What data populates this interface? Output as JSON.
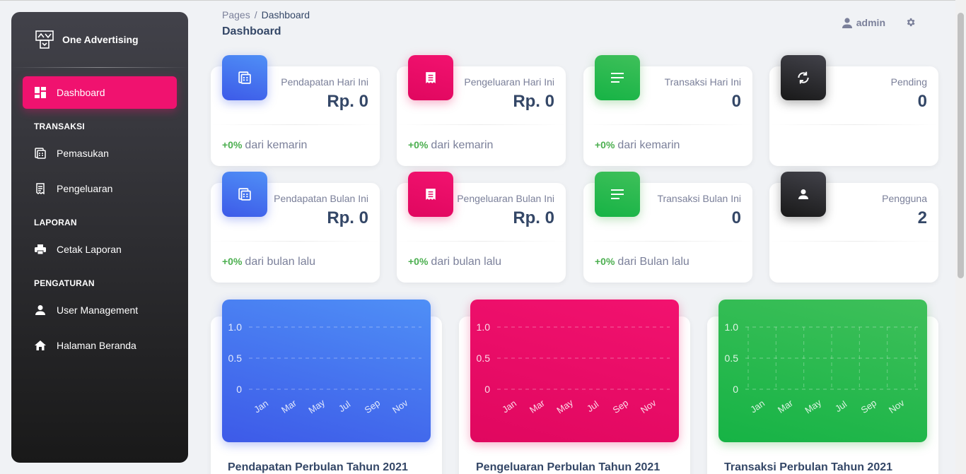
{
  "sidebar": {
    "brand": "One Advertising",
    "items": {
      "dashboard": "Dashboard",
      "section_transaksi": "TRANSAKSI",
      "pemasukan": "Pemasukan",
      "pengeluaran": "Pengeluaran",
      "section_laporan": "LAPORAN",
      "cetak_laporan": "Cetak Laporan",
      "section_pengaturan": "PENGATURAN",
      "user_management": "User Management",
      "halaman_beranda": "Halaman Beranda"
    }
  },
  "header": {
    "breadcrumb_root": "Pages",
    "breadcrumb_sep": "/",
    "breadcrumb_current": "Dashboard",
    "title": "Dashboard",
    "user": "admin"
  },
  "cards": [
    {
      "label": "Pendapatan Hari Ini",
      "value": "Rp. 0",
      "pct": "+0%",
      "foot": "dari kemarin",
      "icon": "calculator-icon"
    },
    {
      "label": "Pengeluaran Hari Ini",
      "value": "Rp. 0",
      "pct": "+0%",
      "foot": "dari kemarin",
      "icon": "receipt-icon"
    },
    {
      "label": "Transaksi Hari Ini",
      "value": "0",
      "pct": "+0%",
      "foot": "dari kemarin",
      "icon": "list-icon"
    },
    {
      "label": "Pending",
      "value": "0",
      "icon": "refresh-icon"
    },
    {
      "label": "Pendapatan Bulan Ini",
      "value": "Rp. 0",
      "pct": "+0%",
      "foot": "dari bulan lalu",
      "icon": "calculator-icon"
    },
    {
      "label": "Pengeluaran Bulan Ini",
      "value": "Rp. 0",
      "pct": "+0%",
      "foot": "dari bulan lalu",
      "icon": "receipt-icon"
    },
    {
      "label": "Transaksi Bulan Ini",
      "value": "0",
      "pct": "+0%",
      "foot": "dari Bulan lalu",
      "icon": "list-icon"
    },
    {
      "label": "Pengguna",
      "value": "2",
      "icon": "person-icon"
    }
  ],
  "colors": {
    "blue": "#3d5ae8",
    "pink": "#f0126f",
    "green": "#16b345",
    "dark": "#191919",
    "positive": "#4caf50"
  },
  "chart_data": [
    {
      "type": "line",
      "title": "Pendapatan Perbulan Tahun 2021",
      "x_tick_labels": [
        "Jan",
        "Mar",
        "May",
        "Jul",
        "Sep",
        "Nov"
      ],
      "y_ticks": [
        "0",
        "0.5",
        "1.0"
      ],
      "ylim": [
        0,
        1
      ],
      "grid": "horizontal",
      "series": [
        {
          "values": []
        }
      ]
    },
    {
      "type": "bar",
      "title": "Pengeluaran Perbulan Tahun 2021",
      "x_tick_labels": [
        "Jan",
        "Mar",
        "May",
        "Jul",
        "Sep",
        "Nov"
      ],
      "y_ticks": [
        "0",
        "0.5",
        "1.0"
      ],
      "ylim": [
        0,
        1
      ],
      "grid": "horizontal",
      "series": [
        {
          "values": []
        }
      ]
    },
    {
      "type": "line",
      "title": "Transaksi Perbulan Tahun 2021",
      "x_tick_labels": [
        "Jan",
        "Mar",
        "May",
        "Jul",
        "Sep",
        "Nov"
      ],
      "y_ticks": [
        "0",
        "0.5",
        "1.0"
      ],
      "ylim": [
        0,
        1
      ],
      "grid": "both",
      "series": [
        {
          "values": []
        }
      ]
    }
  ]
}
